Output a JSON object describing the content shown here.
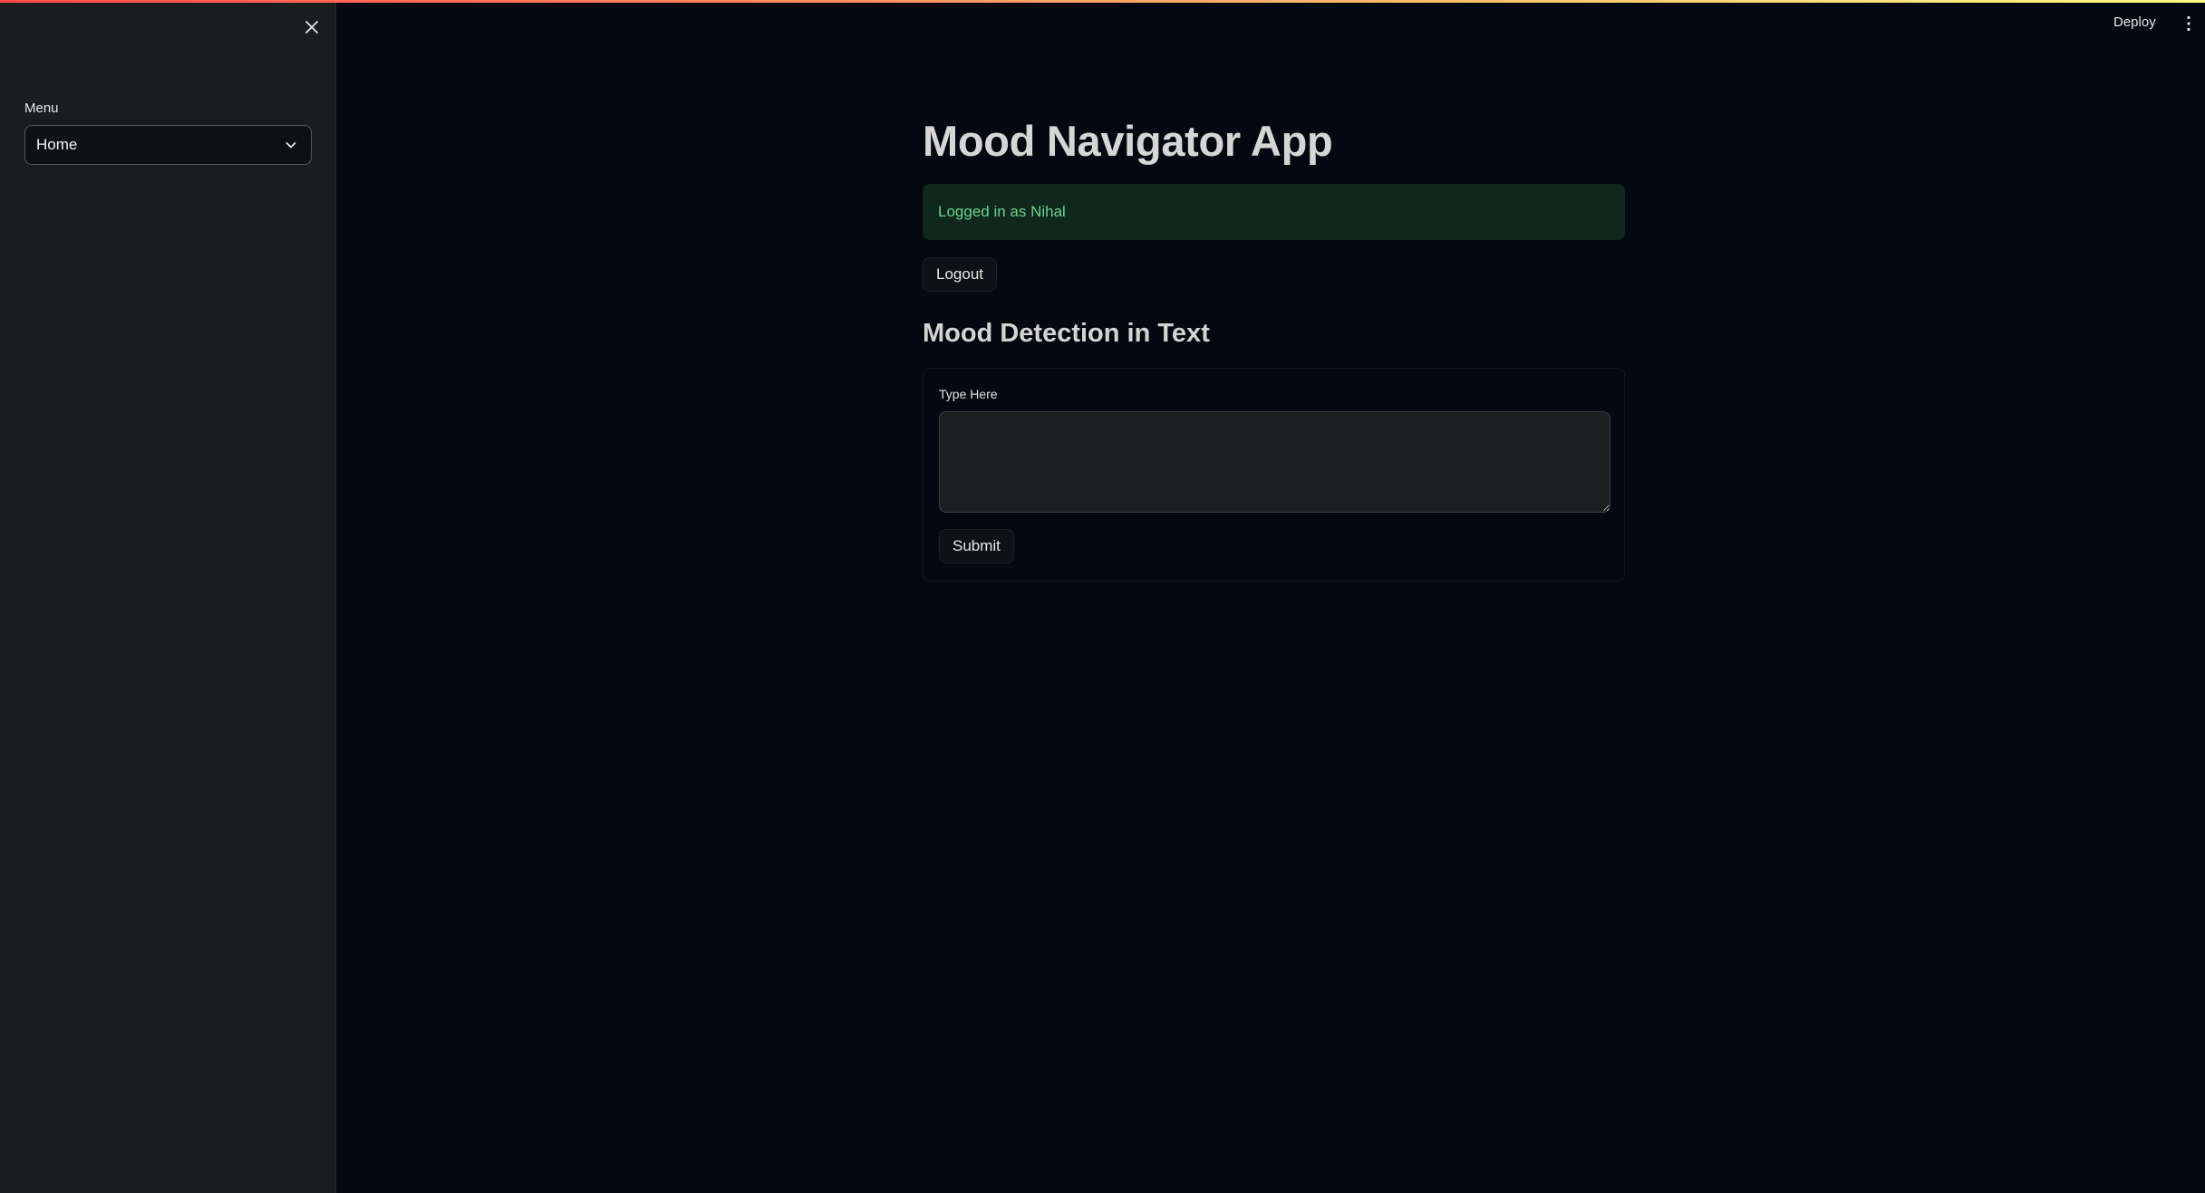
{
  "sidebar": {
    "menu_label": "Menu",
    "menu_selected": "Home",
    "close_icon": "close-icon",
    "chevron_icon": "chevron-down-icon"
  },
  "header": {
    "deploy_label": "Deploy",
    "more_icon": "more-vertical-icon"
  },
  "main": {
    "title": "Mood Navigator App",
    "alert_text": "Logged in as Nihal",
    "logout_label": "Logout",
    "section_heading": "Mood Detection in Text",
    "form": {
      "field_label": "Type Here",
      "field_value": "",
      "submit_label": "Submit"
    }
  },
  "colors": {
    "background": "#050810",
    "sidebar": "#1a1c1f",
    "success_bg": "#0f271c",
    "success_text": "#6bd48f",
    "accent_gradient_start": "#ff4b4b",
    "accent_gradient_end": "#fffd80"
  }
}
